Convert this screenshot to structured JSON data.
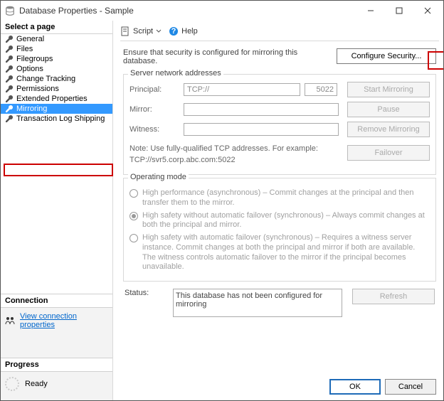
{
  "window": {
    "title": "Database Properties - Sample"
  },
  "left": {
    "selectHeader": "Select a page",
    "items": [
      "General",
      "Files",
      "Filegroups",
      "Options",
      "Change Tracking",
      "Permissions",
      "Extended Properties",
      "Mirroring",
      "Transaction Log Shipping"
    ],
    "selectedIndex": 7,
    "connHeader": "Connection",
    "viewConn": "View connection properties",
    "progressHeader": "Progress",
    "ready": "Ready"
  },
  "toolbar": {
    "script": "Script",
    "help": "Help"
  },
  "ensure": "Ensure that security is configured for mirroring this database.",
  "cfgBtn": "Configure Security...",
  "group": {
    "legend": "Server network addresses",
    "principal": "Principal:",
    "mirror": "Mirror:",
    "witness": "Witness:",
    "tcpValue": "TCP://",
    "port": "5022",
    "note1": "Note: Use fully-qualified TCP addresses. For example:",
    "note2": "TCP://svr5.corp.abc.com:5022",
    "btn": {
      "start": "Start Mirroring",
      "pause": "Pause",
      "remove": "Remove Mirroring",
      "failover": "Failover"
    }
  },
  "op": {
    "legend": "Operating mode",
    "hp": "High performance (asynchronous) – Commit changes at the principal and then transfer them to the mirror.",
    "hs": "High safety without automatic failover (synchronous) – Always commit changes at both the principal and mirror.",
    "hsa": "High safety with automatic failover (synchronous) – Requires a witness server instance. Commit changes at both the principal and mirror if both are available. The witness controls automatic failover to the mirror if the principal becomes unavailable."
  },
  "status": {
    "label": "Status:",
    "value": "This database has not been configured for mirroring",
    "refresh": "Refresh"
  },
  "footer": {
    "ok": "OK",
    "cancel": "Cancel"
  }
}
